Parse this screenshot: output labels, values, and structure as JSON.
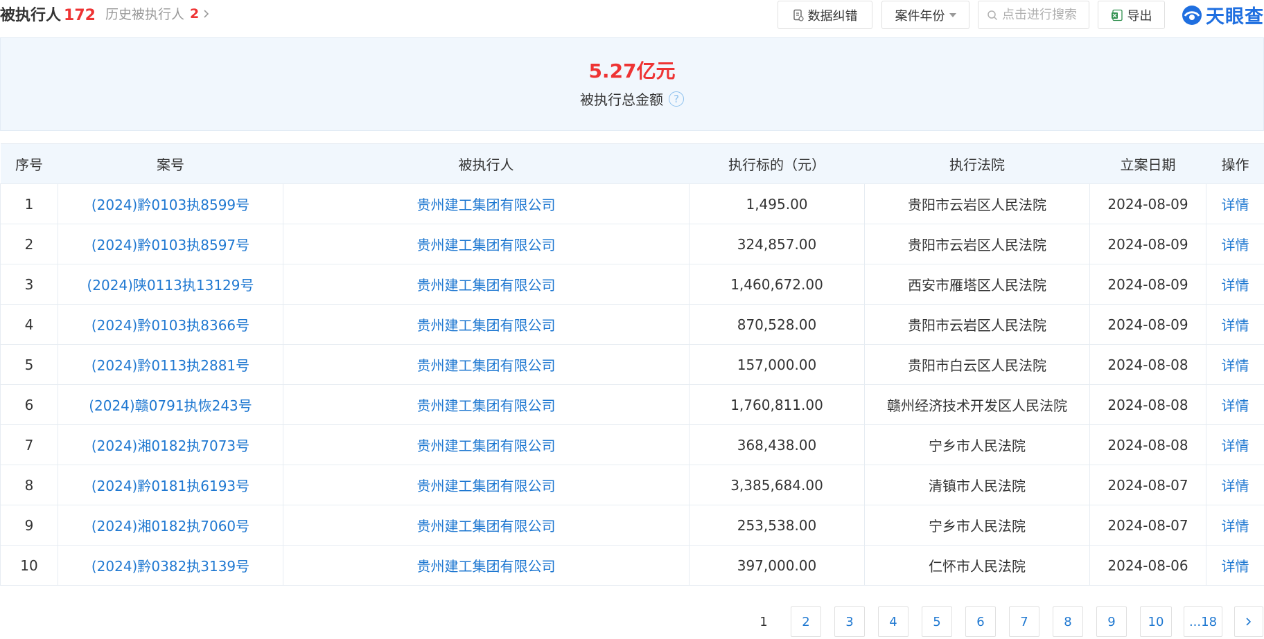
{
  "header": {
    "title": "被执行人",
    "title_count": "172",
    "history_label": "历史被执行人",
    "history_count": "2",
    "buttons": {
      "correct": "数据纠错",
      "year": "案件年份",
      "export": "导出"
    },
    "search_placeholder": "点击进行搜索",
    "logo_text": "天眼查"
  },
  "summary": {
    "amount": "5.27亿元",
    "label": "被执行总金额",
    "help": "?"
  },
  "table": {
    "columns": [
      "序号",
      "案号",
      "被执行人",
      "执行标的（元）",
      "执行法院",
      "立案日期",
      "操作"
    ],
    "rows": [
      {
        "no": "1",
        "case": "(2024)黔0103执8599号",
        "party": "贵州建工集团有限公司",
        "amount": "1,495.00",
        "court": "贵阳市云岩区人民法院",
        "date": "2024-08-09",
        "action": "详情"
      },
      {
        "no": "2",
        "case": "(2024)黔0103执8597号",
        "party": "贵州建工集团有限公司",
        "amount": "324,857.00",
        "court": "贵阳市云岩区人民法院",
        "date": "2024-08-09",
        "action": "详情"
      },
      {
        "no": "3",
        "case": "(2024)陕0113执13129号",
        "party": "贵州建工集团有限公司",
        "amount": "1,460,672.00",
        "court": "西安市雁塔区人民法院",
        "date": "2024-08-09",
        "action": "详情"
      },
      {
        "no": "4",
        "case": "(2024)黔0103执8366号",
        "party": "贵州建工集团有限公司",
        "amount": "870,528.00",
        "court": "贵阳市云岩区人民法院",
        "date": "2024-08-09",
        "action": "详情"
      },
      {
        "no": "5",
        "case": "(2024)黔0113执2881号",
        "party": "贵州建工集团有限公司",
        "amount": "157,000.00",
        "court": "贵阳市白云区人民法院",
        "date": "2024-08-08",
        "action": "详情"
      },
      {
        "no": "6",
        "case": "(2024)赣0791执恢243号",
        "party": "贵州建工集团有限公司",
        "amount": "1,760,811.00",
        "court": "赣州经济技术开发区人民法院",
        "date": "2024-08-08",
        "action": "详情"
      },
      {
        "no": "7",
        "case": "(2024)湘0182执7073号",
        "party": "贵州建工集团有限公司",
        "amount": "368,438.00",
        "court": "宁乡市人民法院",
        "date": "2024-08-08",
        "action": "详情"
      },
      {
        "no": "8",
        "case": "(2024)黔0181执6193号",
        "party": "贵州建工集团有限公司",
        "amount": "3,385,684.00",
        "court": "清镇市人民法院",
        "date": "2024-08-07",
        "action": "详情"
      },
      {
        "no": "9",
        "case": "(2024)湘0182执7060号",
        "party": "贵州建工集团有限公司",
        "amount": "253,538.00",
        "court": "宁乡市人民法院",
        "date": "2024-08-07",
        "action": "详情"
      },
      {
        "no": "10",
        "case": "(2024)黔0382执3139号",
        "party": "贵州建工集团有限公司",
        "amount": "397,000.00",
        "court": "仁怀市人民法院",
        "date": "2024-08-06",
        "action": "详情"
      }
    ]
  },
  "pagination": {
    "current": "1",
    "pages": [
      "2",
      "3",
      "4",
      "5",
      "6",
      "7",
      "8",
      "9",
      "10",
      "...18"
    ],
    "next": "›"
  },
  "colors": {
    "accent": "#1f78d1",
    "highlight": "#ee3333",
    "header_bg": "#f1f7fd"
  }
}
